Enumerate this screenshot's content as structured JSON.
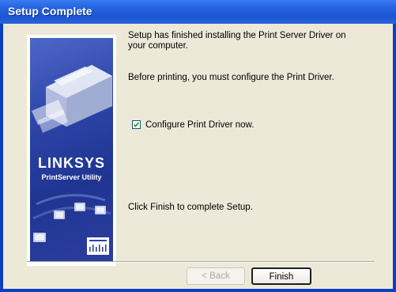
{
  "window": {
    "title": "Setup Complete"
  },
  "banner": {
    "brand": "LINKSYS",
    "product": "PrintServer Utility",
    "logo_icon": "cisco-systems-logo"
  },
  "content": {
    "message_line": "Setup has finished installing the Print Server Driver on your computer.",
    "instruction": "Before printing, you must configure the Print Driver.",
    "checkbox_label": "Configure Print Driver now.",
    "checkbox_checked": true,
    "footer_hint": "Click Finish to complete Setup."
  },
  "buttons": {
    "back_label": "< Back",
    "finish_label": "Finish"
  },
  "colors": {
    "titlebar": "#2566e2",
    "client_bg": "#ece9d8",
    "banner_bg": "#2d44a8"
  }
}
